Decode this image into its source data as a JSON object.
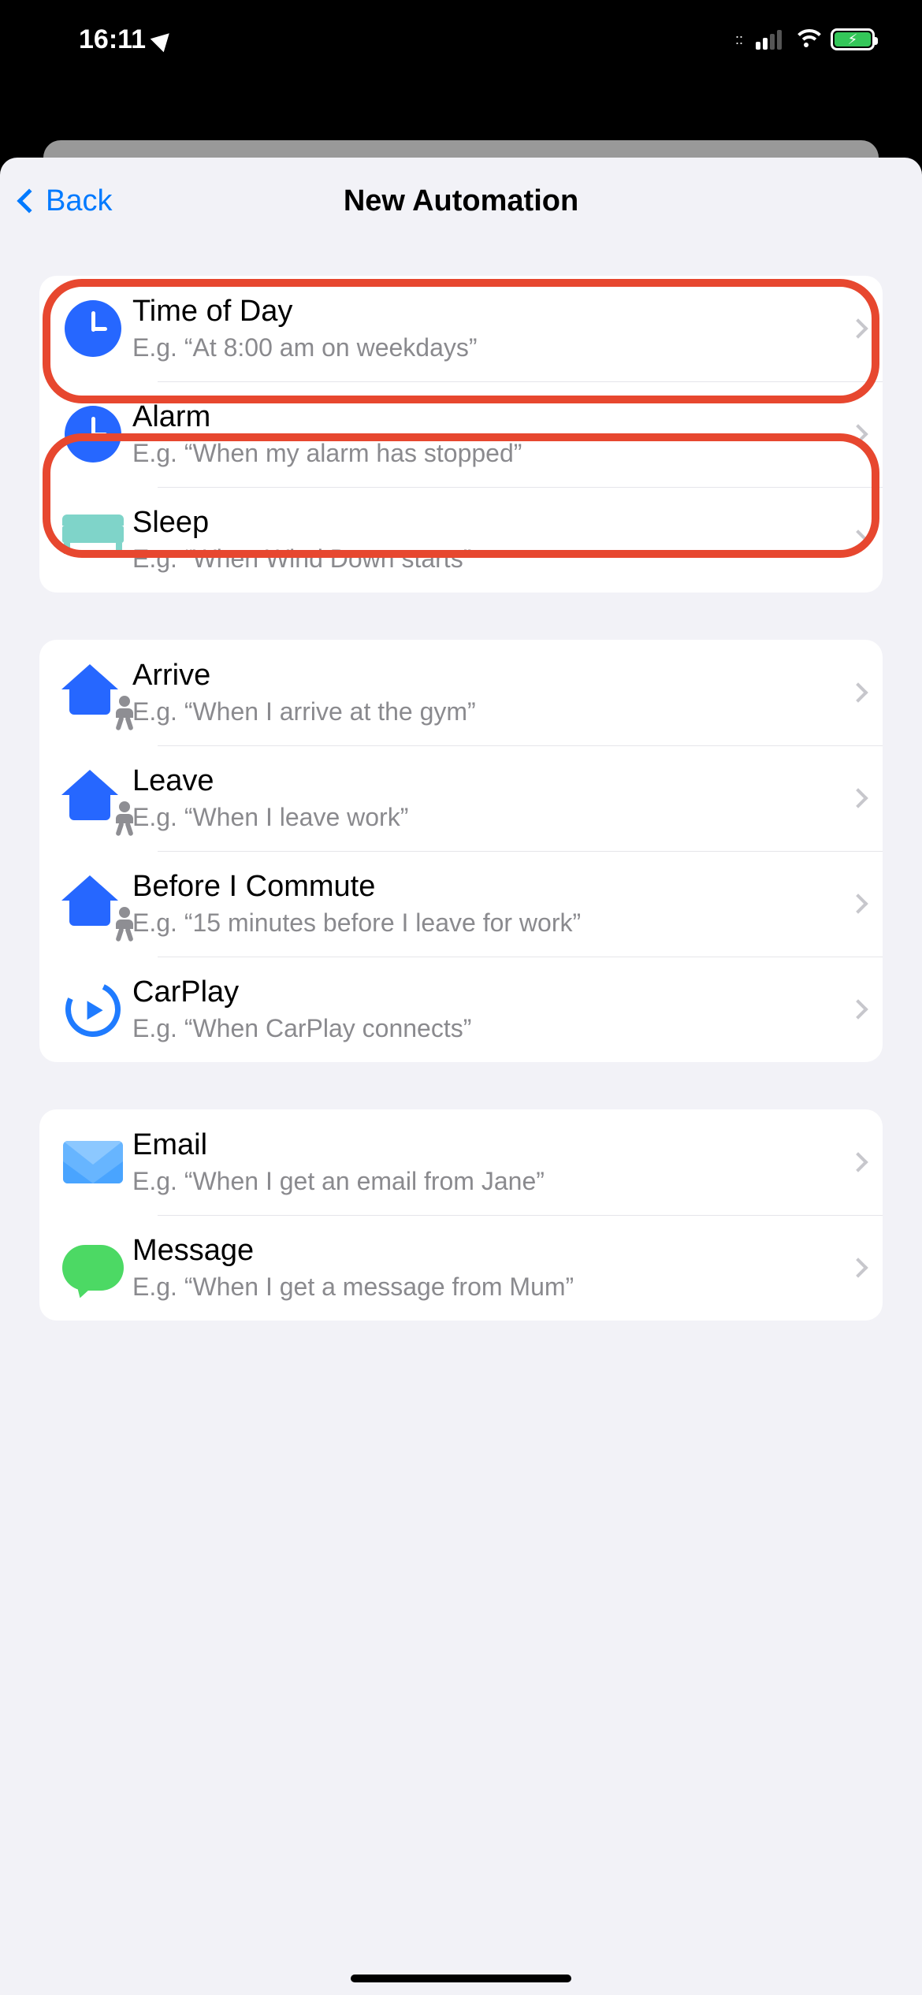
{
  "status": {
    "time": "16:11"
  },
  "nav": {
    "back": "Back",
    "title": "New Automation"
  },
  "groups": [
    {
      "id": "time",
      "rows": [
        {
          "id": "time-of-day",
          "icon": "clock-icon",
          "title": "Time of Day",
          "sub": "E.g. “At 8:00 am on weekdays”",
          "highlighted": true
        },
        {
          "id": "alarm",
          "icon": "clock-icon",
          "title": "Alarm",
          "sub": "E.g. “When my alarm has stopped”",
          "highlighted": true
        },
        {
          "id": "sleep",
          "icon": "bed-icon",
          "title": "Sleep",
          "sub": "E.g. “When Wind Down starts”",
          "highlighted": false
        }
      ]
    },
    {
      "id": "location",
      "rows": [
        {
          "id": "arrive",
          "icon": "house-person-icon",
          "title": "Arrive",
          "sub": "E.g. “When I arrive at the gym”",
          "highlighted": false
        },
        {
          "id": "leave",
          "icon": "house-person-icon",
          "title": "Leave",
          "sub": "E.g. “When I leave work”",
          "highlighted": false
        },
        {
          "id": "commute",
          "icon": "house-person-icon",
          "title": "Before I Commute",
          "sub": "E.g. “15 minutes before I leave for work”",
          "highlighted": false
        },
        {
          "id": "carplay",
          "icon": "carplay-icon",
          "title": "CarPlay",
          "sub": "E.g. “When CarPlay connects”",
          "highlighted": false
        }
      ]
    },
    {
      "id": "comm",
      "rows": [
        {
          "id": "email",
          "icon": "mail-icon",
          "title": "Email",
          "sub": "E.g. “When I get an email from Jane”",
          "highlighted": false
        },
        {
          "id": "message",
          "icon": "message-icon",
          "title": "Message",
          "sub": "E.g. “When I get a message from Mum”",
          "highlighted": false
        }
      ]
    }
  ],
  "colors": {
    "accent": "#007aff",
    "highlight": "#e7472f"
  }
}
